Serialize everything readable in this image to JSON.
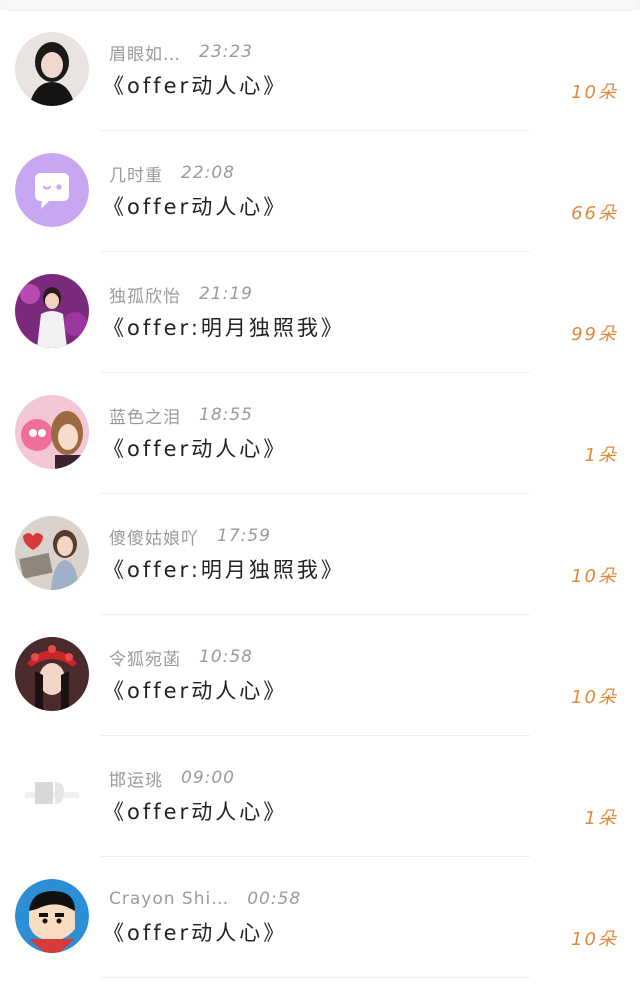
{
  "entries": [
    {
      "name": "眉眼如…",
      "time": "23:23",
      "title": "《offer动人心》",
      "count": "10朵",
      "avatar": "avatar-woman-dark-hair"
    },
    {
      "name": "几时重",
      "time": "22:08",
      "title": "《offer动人心》",
      "count": "66朵",
      "avatar": "avatar-purple-chat-icon"
    },
    {
      "name": "独孤欣怡",
      "time": "21:19",
      "title": "《offer:明月独照我》",
      "count": "99朵",
      "avatar": "avatar-man-white-suit"
    },
    {
      "name": "蓝色之泪",
      "time": "18:55",
      "title": "《offer动人心》",
      "count": "1朵",
      "avatar": "avatar-cartoon-pink"
    },
    {
      "name": "傻傻姑娘吖",
      "time": "17:59",
      "title": "《offer:明月独照我》",
      "count": "10朵",
      "avatar": "avatar-girl-photo"
    },
    {
      "name": "令狐宛菡",
      "time": "10:58",
      "title": "《offer动人心》",
      "count": "10朵",
      "avatar": "avatar-opera-headdress"
    },
    {
      "name": "邯运珧",
      "time": "09:00",
      "title": "《offer动人心》",
      "count": "1朵",
      "avatar": "avatar-faded-white"
    },
    {
      "name": "Crayon Shi…",
      "time": "00:58",
      "title": "《offer动人心》",
      "count": "10朵",
      "avatar": "avatar-crayon-shin"
    }
  ],
  "colors": {
    "accent": "#e08a3a",
    "meta": "#9a9a9a",
    "title": "#222222",
    "purple": "#c8a7f2"
  }
}
